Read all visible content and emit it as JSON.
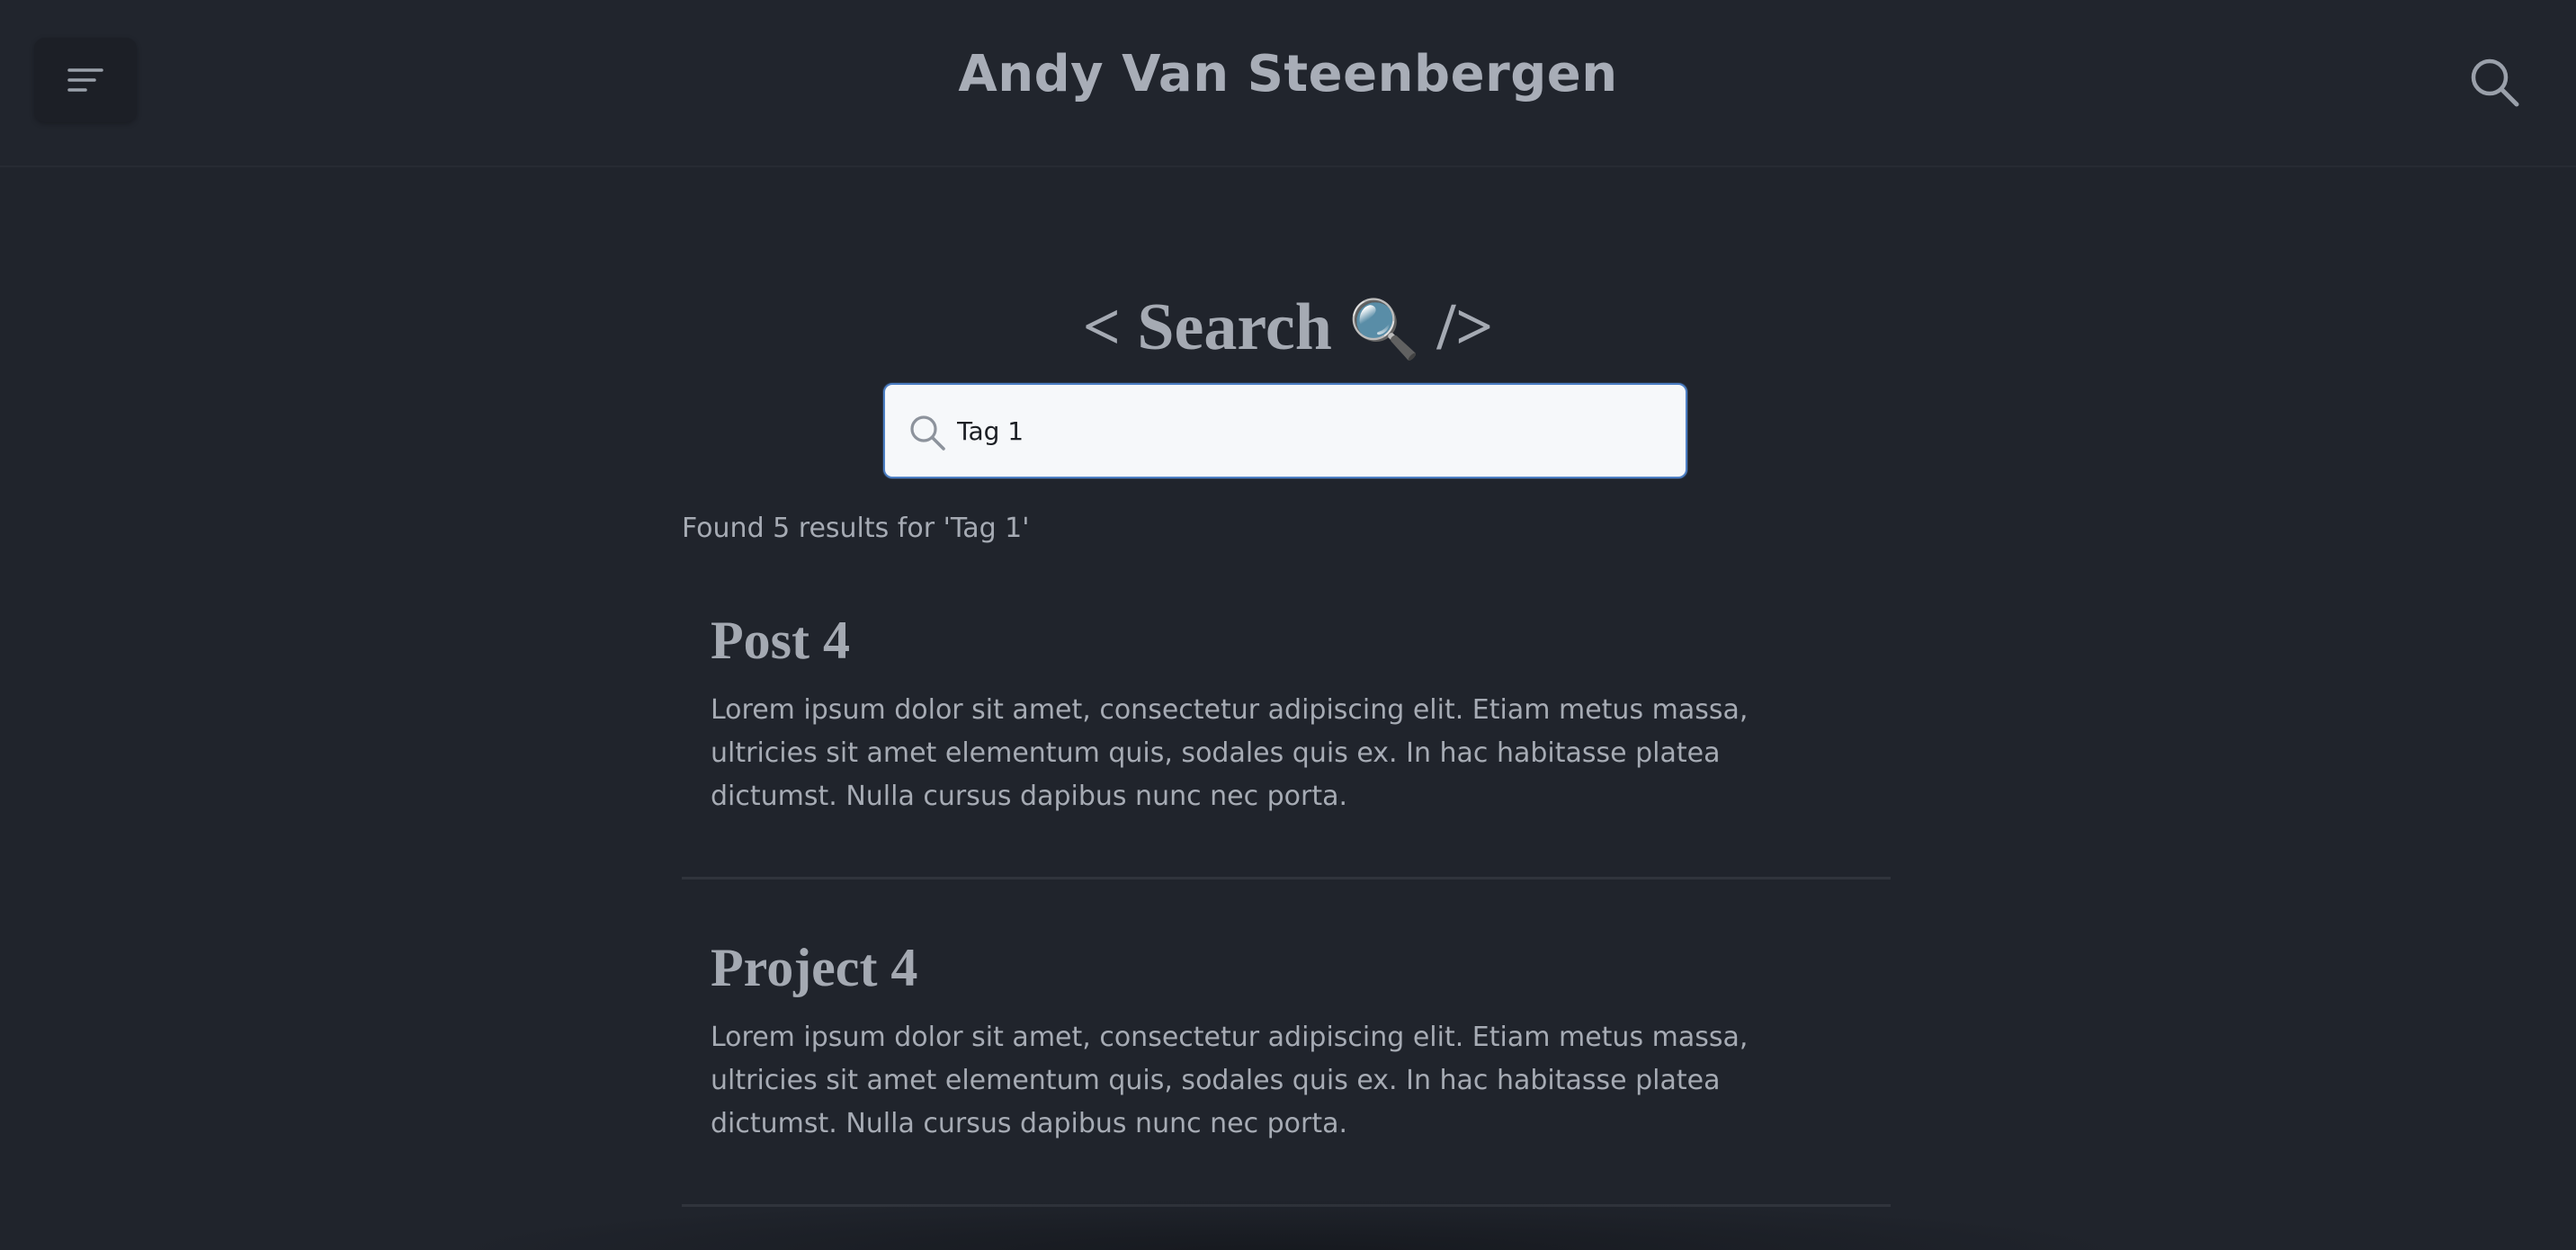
{
  "header": {
    "site_title": "Andy Van Steenbergen",
    "menu_icon": "menu-icon",
    "search_icon": "search-icon"
  },
  "search_page": {
    "heading_open": "< Search",
    "heading_icon": "🔍",
    "heading_close": "/>",
    "input_value": "Tag 1",
    "results_text": "Found 5 results for 'Tag 1'"
  },
  "results": [
    {
      "title": "Post 4",
      "excerpt": "Lorem ipsum dolor sit amet, consectetur adipiscing elit. Etiam metus massa, ultricies sit amet elementum quis, sodales quis ex. In hac habitasse platea dictumst. Nulla cursus dapibus nunc nec porta."
    },
    {
      "title": "Project 4",
      "excerpt": "Lorem ipsum dolor sit amet, consectetur adipiscing elit. Etiam metus massa, ultricies sit amet elementum quis, sodales quis ex. In hac habitasse platea dictumst. Nulla cursus dapibus nunc nec porta."
    }
  ],
  "colors": {
    "background": "#20242c",
    "text": "#a6abb4",
    "input_border": "#4d7fc4"
  }
}
